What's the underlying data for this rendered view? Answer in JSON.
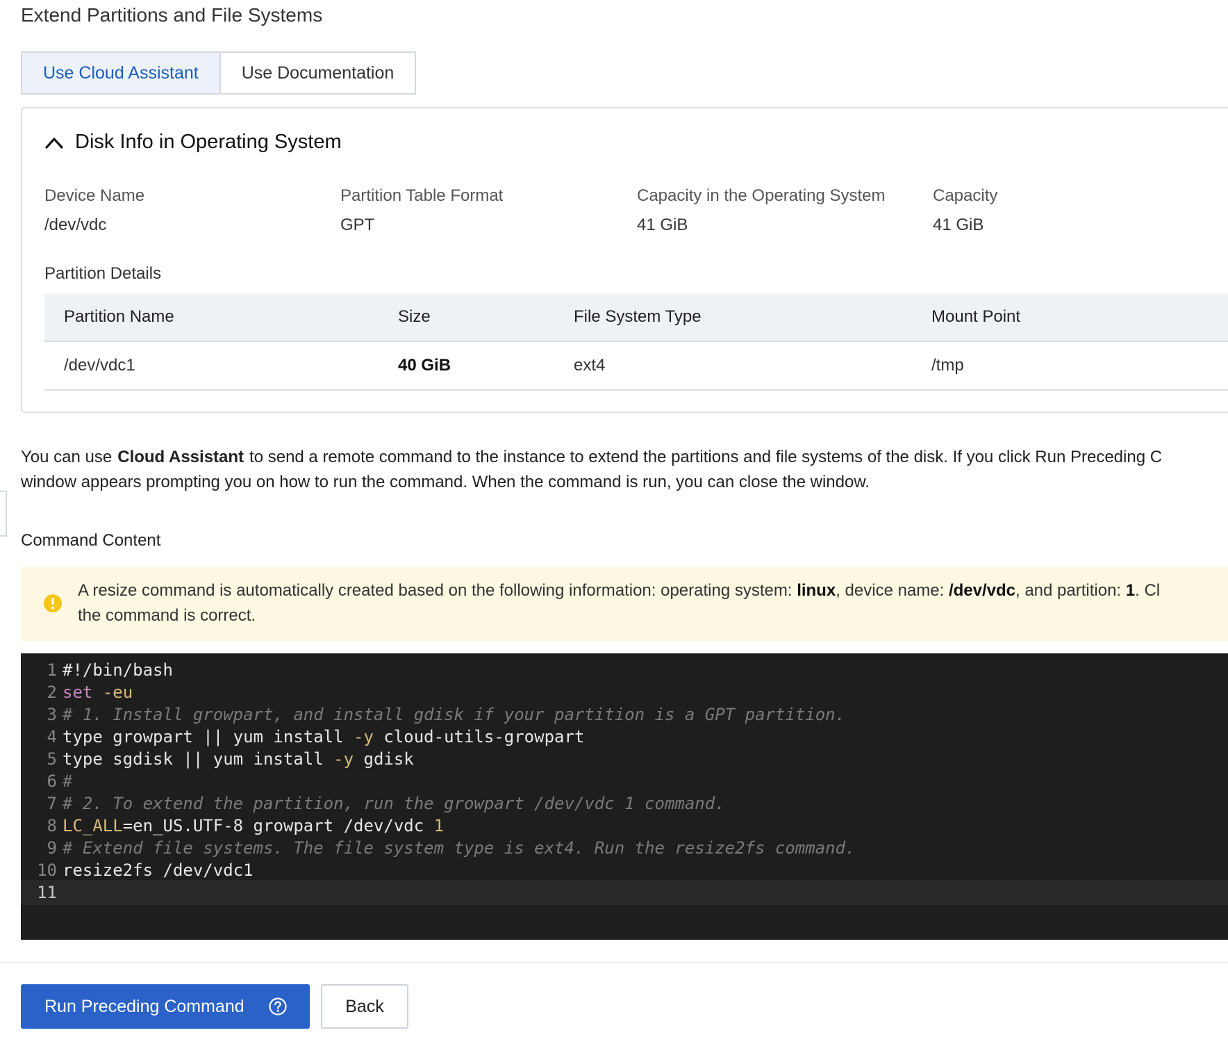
{
  "page": {
    "title": "Extend Partitions and File Systems"
  },
  "tabs": [
    {
      "label": "Use Cloud Assistant",
      "active": true
    },
    {
      "label": "Use Documentation",
      "active": false
    }
  ],
  "disk_info": {
    "title": "Disk Info in Operating System",
    "collapse_icon": "chevron-up-icon",
    "fields": [
      {
        "label": "Device Name",
        "value": "/dev/vdc"
      },
      {
        "label": "Partition Table Format",
        "value": "GPT"
      },
      {
        "label": "Capacity in the Operating System",
        "value": "41 GiB"
      },
      {
        "label": "Capacity",
        "value": "41 GiB"
      }
    ],
    "partition_details": {
      "title": "Partition Details",
      "columns": [
        "Partition Name",
        "Size",
        "File System Type",
        "Mount Point"
      ],
      "rows": [
        {
          "partition_name": "/dev/vdc1",
          "size": "40 GiB",
          "file_system_type": "ext4",
          "mount_point": "/tmp"
        }
      ]
    }
  },
  "description": {
    "part1": "You can use",
    "emph": "Cloud Assistant",
    "part2": "to send a remote command to the instance to extend the partitions and file systems of the disk. If you click Run Preceding C",
    "line2": "window appears prompting you on how to run the command. When the command is run, you can close the window."
  },
  "command": {
    "label": "Command Content",
    "notice": {
      "icon": "warning-circle-icon",
      "color": "#f5c518",
      "t1": "A resize command is automatically created based on the following information: operating system: ",
      "os": "linux",
      "t2": ", device name: ",
      "device": "/dev/vdc",
      "t3": ", and partition: ",
      "partition": "1",
      "t4": ". Cl",
      "line2": "the command is correct."
    },
    "code_lines": [
      {
        "n": "1",
        "a": "#!/bin/bash"
      },
      {
        "n": "2",
        "kw": "set",
        "op": " -eu"
      },
      {
        "n": "3",
        "cm": "# 1. Install growpart, and install gdisk if your partition is a GPT partition."
      },
      {
        "n": "4",
        "a": "type growpart || yum install ",
        "op": "-y",
        "b": " cloud-utils-growpart"
      },
      {
        "n": "5",
        "a": "type sgdisk || yum install ",
        "op": "-y",
        "b": " gdisk"
      },
      {
        "n": "6",
        "cm": "#"
      },
      {
        "n": "7",
        "cm": "# 2. To extend the partition, run the growpart /dev/vdc 1 command."
      },
      {
        "n": "8",
        "op": "LC_ALL",
        "a": "=en_US.UTF-8 growpart /dev/vdc ",
        "num": "1"
      },
      {
        "n": "9",
        "cm": "# Extend file systems. The file system type is ext4. Run the resize2fs command."
      },
      {
        "n": "10",
        "a": "resize2fs /dev/vdc1"
      },
      {
        "n": "11"
      }
    ]
  },
  "footer": {
    "run_label": "Run Preceding Command",
    "help_icon": "question-circle-icon",
    "back_label": "Back",
    "primary_color": "#2a62c9"
  }
}
